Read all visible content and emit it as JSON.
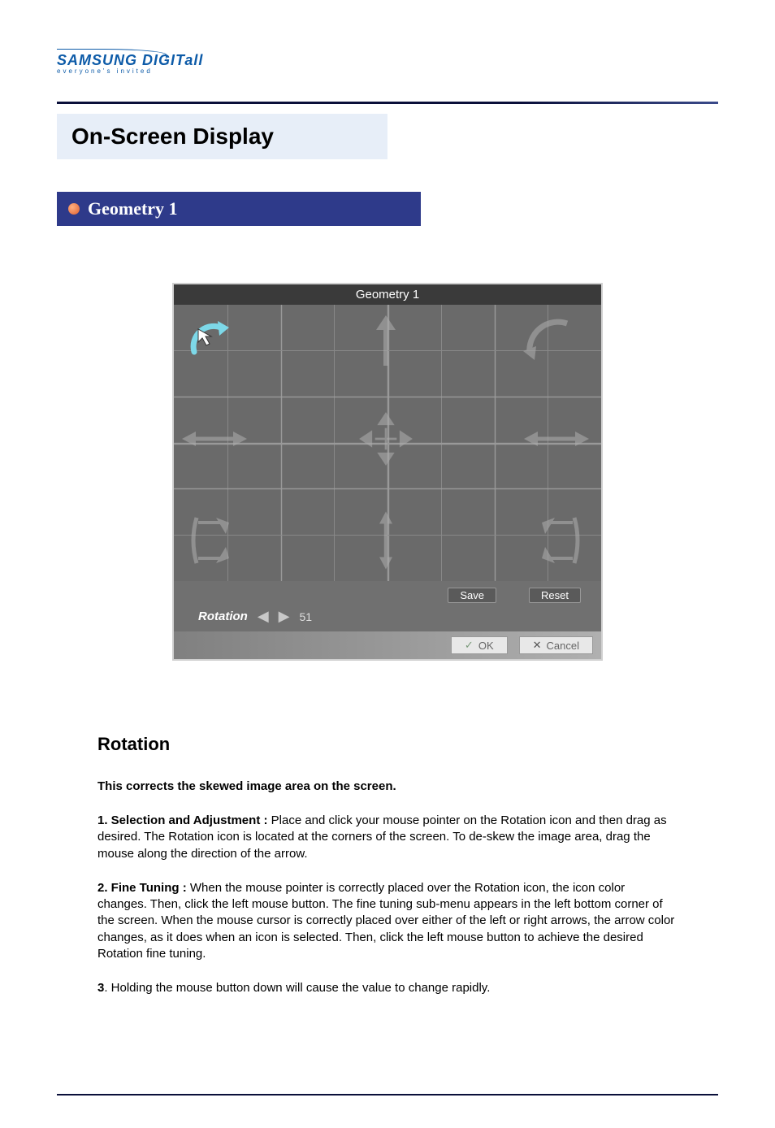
{
  "logo": {
    "main": "SAMSUNG DIGIT",
    "main_suffix": "all",
    "sub": "everyone's invited"
  },
  "page_title": "On-Screen Display",
  "section_title": "Geometry 1",
  "osd": {
    "title": "Geometry 1",
    "control_label": "Rotation",
    "value": "51",
    "buttons": {
      "save": "Save",
      "reset": "Reset",
      "ok": "OK",
      "cancel": "Cancel"
    }
  },
  "content": {
    "heading": "Rotation",
    "intro": "This corrects the skewed image area on the screen.",
    "para1_lead": "1. Selection and Adjustment : ",
    "para1_body": "Place and click your mouse pointer on the Rotation icon and then drag as desired. The Rotation icon is located at the corners of the screen. To de-skew the image area, drag the mouse along the direction of the arrow.",
    "para2_lead": "2. Fine Tuning : ",
    "para2_body": "When the mouse pointer is correctly placed over the Rotation icon, the icon color changes. Then, click the left mouse button. The fine tuning sub-menu appears in the left bottom corner of the screen. When the mouse cursor is correctly placed over either of the left or right arrows, the arrow color changes, as it does when an icon is selected. Then, click the left mouse button to achieve the desired Rotation fine tuning.",
    "para3_lead": "3",
    "para3_body": ". Holding the mouse button down will cause the value to change rapidly."
  }
}
